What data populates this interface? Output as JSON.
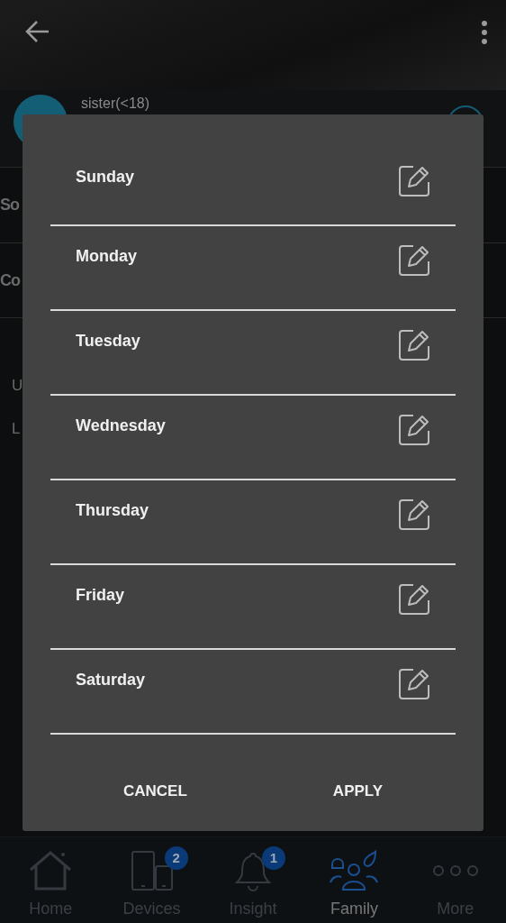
{
  "profile": {
    "name": "sister(<18)"
  },
  "settings_rows": [
    {
      "label": "So"
    },
    {
      "label": "Co"
    }
  ],
  "section_labels": [
    "U",
    "L"
  ],
  "dialog": {
    "days": [
      {
        "label": "Sunday"
      },
      {
        "label": "Monday"
      },
      {
        "label": "Tuesday"
      },
      {
        "label": "Wednesday"
      },
      {
        "label": "Thursday"
      },
      {
        "label": "Friday"
      },
      {
        "label": "Saturday"
      }
    ],
    "buttons": [
      "CANCEL",
      "APPLY"
    ]
  },
  "bottom_nav": [
    {
      "label": "Home",
      "kind": "home",
      "selected": false
    },
    {
      "label": "Devices",
      "kind": "devices",
      "selected": false,
      "badge": "2"
    },
    {
      "label": "Insight",
      "kind": "insight",
      "selected": false,
      "badge": "1"
    },
    {
      "label": "Family",
      "kind": "family",
      "selected": true
    },
    {
      "label": "More",
      "kind": "more",
      "selected": false
    }
  ]
}
